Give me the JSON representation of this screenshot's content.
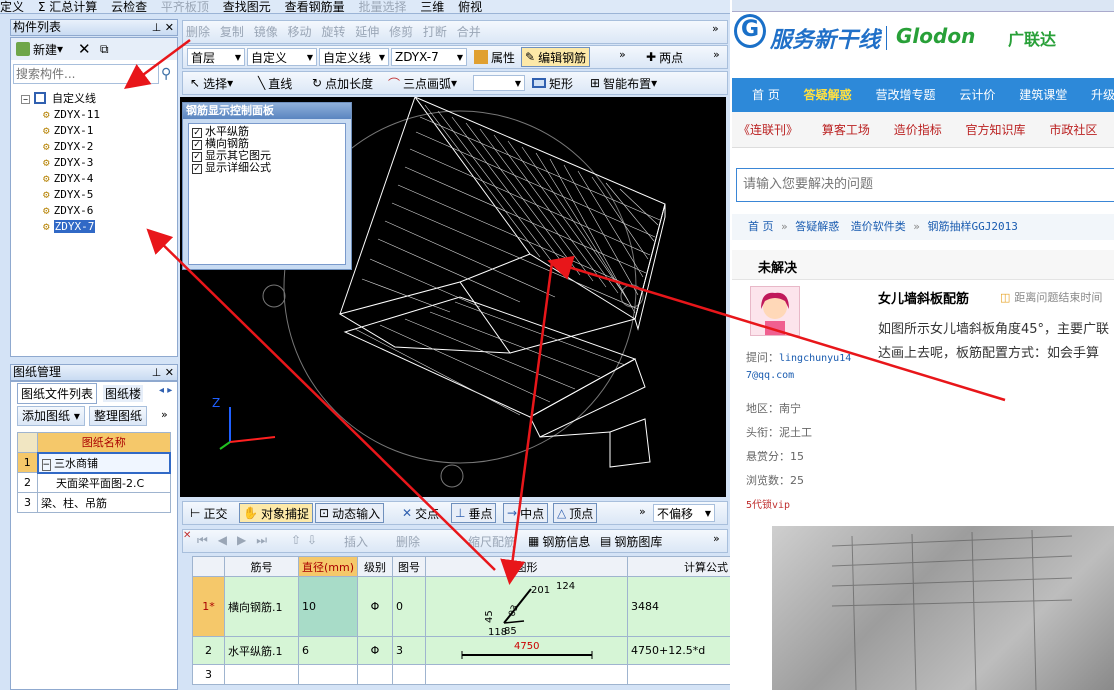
{
  "top_menu": [
    "定义",
    "Σ 汇总计算",
    "云检查",
    "平齐板顶",
    "查找图元",
    "查看钢筋量",
    "批量选择",
    "三维",
    "俯视"
  ],
  "component_list": {
    "title": "构件列表",
    "new_label": "新建",
    "search_placeholder": "搜索构件...",
    "root": "自定义线",
    "items": [
      "ZDYX-11",
      "ZDYX-1",
      "ZDYX-2",
      "ZDYX-3",
      "ZDYX-4",
      "ZDYX-5",
      "ZDYX-6",
      "ZDYX-7"
    ]
  },
  "drawing_mgmt": {
    "title": "图纸管理",
    "tab1": "图纸文件列表",
    "tab2": "图纸楼",
    "add_btn": "添加图纸",
    "organize_btn": "整理图纸",
    "col_header": "图纸名称",
    "rows": [
      {
        "no": "1",
        "name": "三水商铺"
      },
      {
        "no": "2",
        "name": "天面梁平面图-2.C"
      },
      {
        "no": "3",
        "name": "梁、柱、吊筋"
      }
    ]
  },
  "edit_toolbar": [
    "删除",
    "复制",
    "镜像",
    "移动",
    "旋转",
    "延伸",
    "修剪",
    "打断",
    "合并"
  ],
  "layer_toolbar": {
    "floor": "首层",
    "category": "自定义",
    "type": "自定义线",
    "name": "ZDYX-7",
    "properties": "属性",
    "edit_rebar": "编辑钢筋",
    "two_points": "两点"
  },
  "draw_toolbar": {
    "select": "选择",
    "line": "直线",
    "point_length": "点加长度",
    "arc": "三点画弧",
    "rect": "矩形",
    "smart": "智能布置"
  },
  "rebar_panel": {
    "title": "钢筋显示控制面板",
    "options": [
      "水平纵筋",
      "横向钢筋",
      "显示其它图元",
      "显示详细公式"
    ]
  },
  "snap_toolbar": {
    "ortho": "正交",
    "snap": "对象捕捉",
    "dynamic": "动态输入",
    "intersect": "交点",
    "perp": "垂点",
    "mid": "中点",
    "vertex": "顶点",
    "offset": "不偏移"
  },
  "rebar_toolbar": [
    "插入",
    "删除",
    "缩尺配筋",
    "钢筋信息",
    "钢筋图库"
  ],
  "rebar_table": {
    "headers": [
      "筋号",
      "直径(mm)",
      "级别",
      "图号",
      "图形",
      "计算公式"
    ],
    "rows": [
      {
        "idx": "1*",
        "name": "横向钢筋.1",
        "dia": "10",
        "grade": "Φ",
        "fig": "0",
        "formula": "3484"
      },
      {
        "idx": "2",
        "name": "水平纵筋.1",
        "dia": "6",
        "grade": "Φ",
        "fig": "3",
        "formula": "4750+12.5*d"
      },
      {
        "idx": "3",
        "name": "",
        "dia": "",
        "grade": "",
        "fig": "",
        "formula": ""
      }
    ],
    "shape1_labels": [
      "201",
      "124",
      "45",
      "118",
      "85",
      "03"
    ],
    "shape2_label": "4750"
  },
  "web": {
    "logo_cn": "服务新干线",
    "logo_en": "Glodon",
    "logo_brand": "广联达",
    "nav1": [
      "首 页",
      "答疑解惑",
      "营改增专题",
      "云计价",
      "建筑课堂",
      "升级下载"
    ],
    "nav2": [
      "《连联刊》",
      "算客工场",
      "造价指标",
      "官方知识库",
      "市政社区",
      "建"
    ],
    "search_placeholder": "请输入您要解决的问题",
    "breadcrumb": [
      "首 页",
      "答疑解惑",
      "造价软件类",
      "钢筋抽样GGJ2013"
    ],
    "status": "未解决",
    "question_title": "女儿墙斜板配筋",
    "question_time": "距离问题结束时间",
    "question_body": "如图所示女儿墙斜板角度45°，主要广联达画上去呢，板筋配置方式：如会手算",
    "asker_label": "提问：",
    "asker": "lingchunyu14 7@qq.com",
    "region": "地区：南宁",
    "rank": "头衔：泥土工",
    "reward": "悬赏分：15",
    "views": "浏览数：25",
    "vip": "5代锁vip"
  },
  "colors": {
    "arrow": "#e8161a",
    "nav_blue": "#2d89d9",
    "grid_green": "#d6f5d6"
  }
}
